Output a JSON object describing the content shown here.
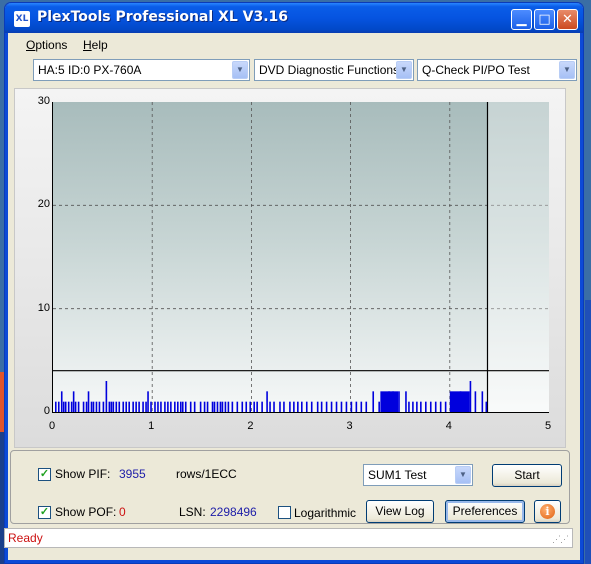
{
  "window": {
    "title": "PlexTools Professional XL V3.16",
    "icon_label": "XL"
  },
  "menu": [
    {
      "accel": "O",
      "rest": "ptions"
    },
    {
      "accel": "H",
      "rest": "elp"
    }
  ],
  "toolbar": {
    "drive": "HA:5 ID:0  PX-760A",
    "function": "DVD Diagnostic Functions",
    "test": "Q-Check PI/PO Test"
  },
  "chart_data": {
    "type": "bar",
    "title": "",
    "xlabel": "",
    "ylabel": "",
    "xlim": [
      0,
      5
    ],
    "ylim": [
      0,
      30
    ],
    "x_ticks": [
      "0",
      "1",
      "2",
      "3",
      "4",
      "5"
    ],
    "y_ticks": [
      "0",
      "10",
      "20",
      "30"
    ],
    "grid": true,
    "threshold_line": 4,
    "progress_end_x": 4.38,
    "series": [
      {
        "color": "#0000dd",
        "x": [
          0.02,
          0.05,
          0.08,
          0.1,
          0.12,
          0.15,
          0.18,
          0.2,
          0.22,
          0.25,
          0.3,
          0.33,
          0.35,
          0.38,
          0.4,
          0.43,
          0.46,
          0.5,
          0.53,
          0.56,
          0.58,
          0.6,
          0.63,
          0.66,
          0.7,
          0.73,
          0.76,
          0.8,
          0.83,
          0.86,
          0.9,
          0.93,
          0.95,
          0.98,
          1.02,
          1.05,
          1.08,
          1.12,
          1.15,
          1.18,
          1.22,
          1.25,
          1.28,
          1.3,
          1.33,
          1.38,
          1.42,
          1.48,
          1.52,
          1.55,
          1.6,
          1.62,
          1.65,
          1.68,
          1.7,
          1.73,
          1.76,
          1.8,
          1.85,
          1.9,
          1.94,
          1.98,
          2.02,
          2.05,
          2.1,
          2.15,
          2.18,
          2.22,
          2.28,
          2.32,
          2.38,
          2.42,
          2.46,
          2.5,
          2.55,
          2.6,
          2.66,
          2.7,
          2.75,
          2.8,
          2.85,
          2.9,
          2.95,
          3.0,
          3.05,
          3.1,
          3.15,
          3.22,
          3.28,
          3.38,
          3.42,
          3.48,
          3.55,
          3.58,
          3.62,
          3.66,
          3.7,
          3.75,
          3.8,
          3.85,
          3.9,
          3.95,
          4.05,
          4.1,
          4.2,
          4.25,
          4.32,
          4.36
        ],
        "values": [
          1,
          1,
          2,
          1,
          1,
          1,
          1,
          2,
          1,
          1,
          1,
          1,
          2,
          1,
          1,
          1,
          1,
          1,
          3,
          1,
          1,
          1,
          1,
          1,
          1,
          1,
          1,
          1,
          1,
          1,
          1,
          1,
          2,
          1,
          1,
          1,
          1,
          1,
          1,
          1,
          1,
          1,
          1,
          1,
          1,
          1,
          1,
          1,
          1,
          1,
          1,
          1,
          1,
          1,
          1,
          1,
          1,
          1,
          1,
          1,
          1,
          1,
          1,
          1,
          1,
          2,
          1,
          1,
          1,
          1,
          1,
          1,
          1,
          1,
          1,
          1,
          1,
          1,
          1,
          1,
          1,
          1,
          1,
          1,
          1,
          1,
          1,
          2,
          1,
          2,
          2,
          2,
          2,
          1,
          1,
          1,
          1,
          1,
          1,
          1,
          1,
          1,
          1,
          2,
          3,
          2,
          2,
          1
        ]
      }
    ]
  },
  "controls": {
    "show_pif_label": "Show PIF:",
    "pif_value": "3955",
    "pif_unit": "rows/1ECC",
    "show_pof_label": "Show POF:",
    "pof_value": "0",
    "lsn_label": "LSN:",
    "lsn_value": "2298496",
    "log_label": "Logarithmic",
    "test_mode": "SUM1 Test",
    "start_label": "Start",
    "viewlog_label": "View Log",
    "prefs_label": "Preferences",
    "info_label": "i",
    "show_pif_checked": true,
    "show_pof_checked": true,
    "logarithmic_checked": false
  },
  "status": {
    "text": "Ready"
  }
}
